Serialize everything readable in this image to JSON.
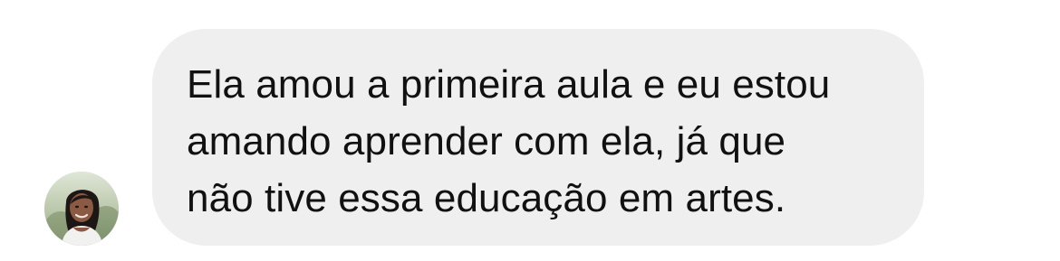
{
  "message": {
    "text": "Ela amou a primeira aula e eu estou\namando aprender com ela, já que\nnão tive essa educação em artes.",
    "bubble_color": "#efefef",
    "text_color": "#111111"
  },
  "avatar": {
    "icon": "user-avatar-photo"
  }
}
